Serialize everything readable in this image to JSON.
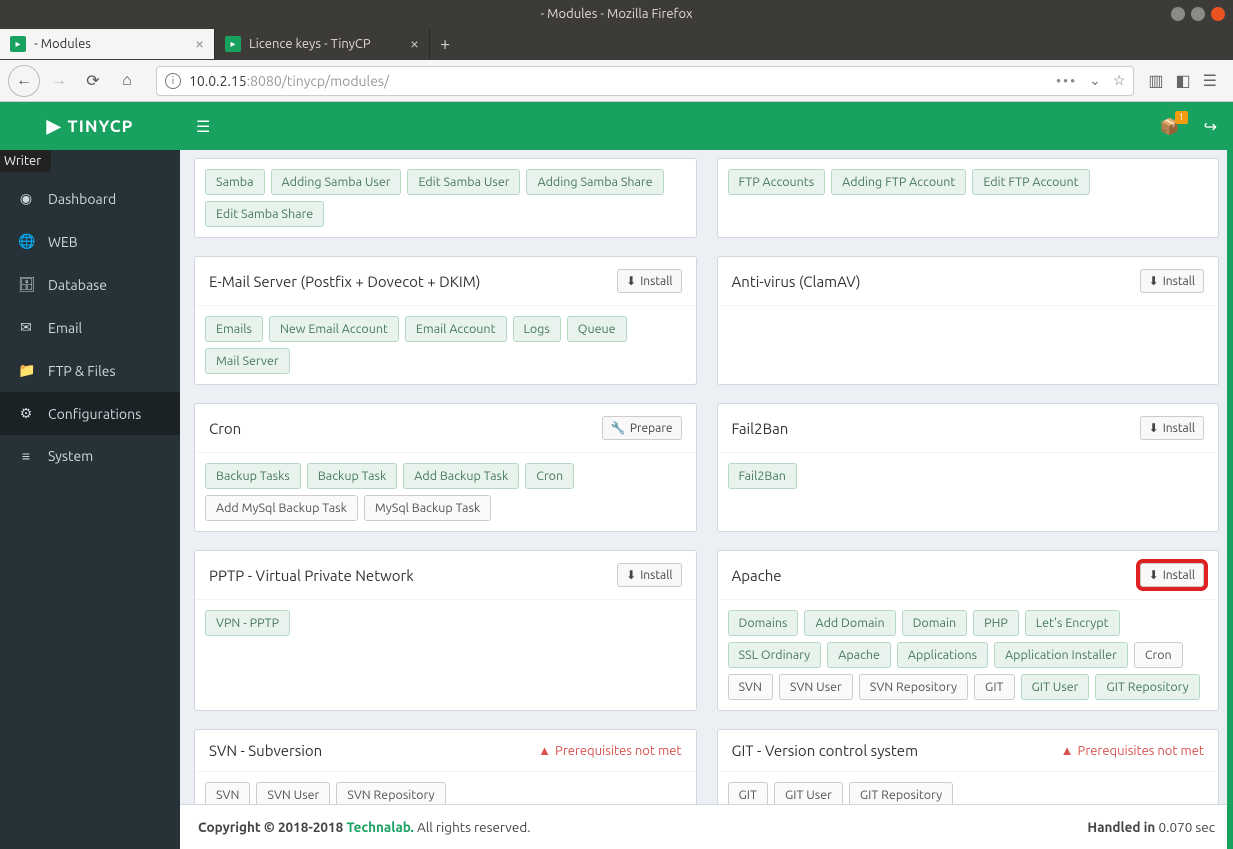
{
  "os": {
    "title": "- Modules - Mozilla Firefox"
  },
  "tabs": [
    {
      "label": "- Modules",
      "active": true
    },
    {
      "label": "Licence keys - TinyCP",
      "active": false
    }
  ],
  "url": {
    "host": "10.0.2.15",
    "port": ":8080",
    "path": "/tinycp/modules/"
  },
  "writer_badge": "Writer",
  "brand": "TINYCP",
  "menu_label": "MENU",
  "nav": [
    {
      "icon": "◉",
      "label": "Dashboard"
    },
    {
      "icon": "🌐",
      "label": "WEB"
    },
    {
      "icon": "🗄",
      "label": "Database"
    },
    {
      "icon": "✉",
      "label": "Email"
    },
    {
      "icon": "📁",
      "label": "FTP & Files"
    },
    {
      "icon": "⚙",
      "label": "Configurations"
    },
    {
      "icon": "≡",
      "label": "System"
    }
  ],
  "cube_badge": "1",
  "cards": {
    "samba": {
      "tags": [
        "Samba",
        "Adding Samba User",
        "Edit Samba User",
        "Adding Samba Share",
        "Edit Samba Share"
      ],
      "green": [
        0,
        1,
        2,
        3,
        4
      ]
    },
    "ftp": {
      "tags": [
        "FTP Accounts",
        "Adding FTP Account",
        "Edit FTP Account"
      ],
      "green": [
        0,
        1,
        2
      ]
    },
    "email": {
      "title": "E-Mail Server (Postfix + Dovecot + DKIM)",
      "action": "Install",
      "tags": [
        "Emails",
        "New Email Account",
        "Email Account",
        "Logs",
        "Queue",
        "Mail Server"
      ],
      "green": [
        0,
        1,
        2,
        3,
        4,
        5
      ]
    },
    "clamav": {
      "title": "Anti-virus (ClamAV)",
      "action": "Install"
    },
    "cron": {
      "title": "Cron",
      "action": "Prepare",
      "action_icon": "wrench",
      "tags": [
        "Backup Tasks",
        "Backup Task",
        "Add Backup Task",
        "Cron",
        "Add MySql Backup Task",
        "MySql Backup Task"
      ],
      "green": [
        0,
        1,
        2,
        3
      ]
    },
    "fail2ban": {
      "title": "Fail2Ban",
      "action": "Install",
      "tags": [
        "Fail2Ban"
      ],
      "green": [
        0
      ]
    },
    "pptp": {
      "title": "PPTP - Virtual Private Network",
      "action": "Install",
      "tags": [
        "VPN - PPTP"
      ],
      "green": [
        0
      ]
    },
    "apache": {
      "title": "Apache",
      "action": "Install",
      "highlight": true,
      "tags": [
        "Domains",
        "Add Domain",
        "Domain",
        "PHP",
        "Let's Encrypt",
        "SSL Ordinary",
        "Apache",
        "Applications",
        "Application Installer",
        "Cron",
        "SVN",
        "SVN User",
        "SVN Repository",
        "GIT",
        "GIT User",
        "GIT Repository"
      ],
      "green": [
        0,
        1,
        2,
        3,
        4,
        5,
        6,
        7,
        8,
        14,
        15
      ]
    },
    "svn": {
      "title": "SVN - Subversion",
      "warn": "Prerequisites not met",
      "tags": [
        "SVN",
        "SVN User",
        "SVN Repository"
      ],
      "green": []
    },
    "git": {
      "title": "GIT - Version control system",
      "warn": "Prerequisites not met",
      "tags": [
        "GIT",
        "GIT User",
        "GIT Repository"
      ],
      "green": []
    }
  },
  "footer": {
    "copyright": "Copyright © 2018-2018 ",
    "company": "Technalab.",
    "rights": " All rights reserved.",
    "handled_label": "Handled in ",
    "handled_time": "0.070 sec"
  }
}
